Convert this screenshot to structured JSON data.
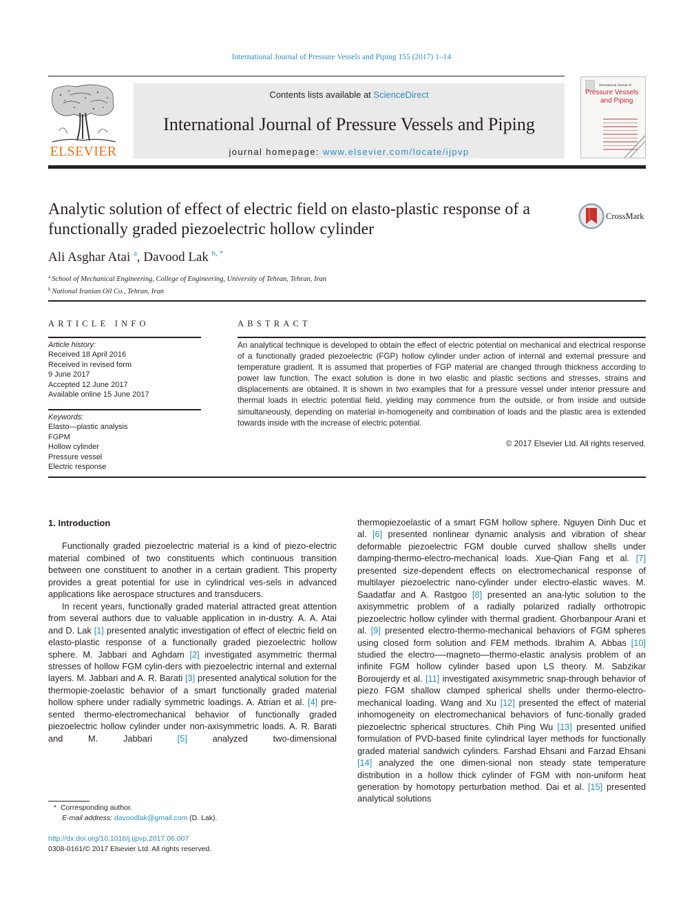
{
  "running_head": "International Journal of Pressure Vessels and Piping 155 (2017) 1–14",
  "masthead": {
    "publisher": "ELSEVIER",
    "contents_prefix": "Contents lists available at ",
    "contents_link": "ScienceDirect",
    "journal_title": "International Journal of Pressure Vessels and Piping",
    "homepage_prefix": "journal homepage: ",
    "homepage_link": "www.elsevier.com/locate/ijpvp",
    "cover": {
      "small_text": "International Journal of",
      "title_line1": "Pressure Vessels",
      "title_line2": "and Piping"
    },
    "brand_color": "#e9711c",
    "link_color": "#2a8cbf"
  },
  "article": {
    "title": "Analytic solution of effect of electric field on elasto-plastic response of a functionally graded piezoelectric hollow cylinder",
    "crossmark_label": "CrossMark",
    "authors": [
      {
        "name": "Ali Asghar Atai",
        "sup": "a"
      },
      {
        "name": "Davood Lak",
        "sup": "b, *"
      }
    ],
    "author_separator": ", ",
    "affiliations": [
      {
        "sup": "a",
        "text": "School of Mechanical Engineering, College of Engineering, University of Tehran, Tehran, Iran"
      },
      {
        "sup": "b",
        "text": "National Iranian Oil Co., Tehran, Iran"
      }
    ]
  },
  "article_info": {
    "heading": "ARTICLE INFO",
    "history_label": "Article history:",
    "history": [
      "Received 18 April 2016",
      "Received in revised form",
      "9 June 2017",
      "Accepted 12 June 2017",
      "Available online 15 June 2017"
    ],
    "keywords_label": "Keywords:",
    "keywords": [
      "Elasto—plastic analysis",
      "FGPM",
      "Hollow cylinder",
      "Pressure vessel",
      "Electric response"
    ]
  },
  "abstract": {
    "heading": "ABSTRACT",
    "text": "An analytical technique is developed to obtain the effect of electric potential on mechanical and electrical response of a functionally graded piezoelectric (FGP) hollow cylinder under action of internal and external pressure and temperature gradient. It is assumed that properties of FGP material are changed through thickness according to power law function. The exact solution is done in two elastic and plastic sections and stresses, strains and displacements are obtained. It is shown in two examples that for a pressure vessel under interior pressure and thermal loads in electric potential field, yielding may commence from the outside, or from inside and outside simultaneously, depending on material in-homogeneity and combination of loads and the plastic area is extended towards inside with the increase of electric potential.",
    "copyright": "© 2017 Elsevier Ltd. All rights reserved."
  },
  "body": {
    "section_title": "1.  Introduction",
    "left_paragraphs": [
      [
        {
          "t": "Functionally graded piezoelectric material is a kind of piezo-electric material combined of two constituents which continuous transition between one constituent to another in a certain gradient. This property provides a great potential for use in cylindrical ves-sels in advanced applications like aerospace structures and transducers."
        }
      ],
      [
        {
          "t": "In recent years, functionally graded material attracted great attention from several authors due to valuable application in in-dustry. A. A. Atai and D. Lak "
        },
        {
          "r": "[1]"
        },
        {
          "t": " presented analytic investigation of effect of electric field on elasto-plastic response of a functionally graded piezoelectric hollow sphere. M. Jabbari and Aghdam "
        },
        {
          "r": "[2]"
        },
        {
          "t": " investigated asymmetric thermal stresses of hollow FGM cylin-ders with piezoelectric internal and external layers. M. Jabbari and A. R. Barati "
        },
        {
          "r": "[3]"
        },
        {
          "t": " presented analytical solution for the thermopie-zoelastic behavior of a smart functionally graded material hollow sphere under radially symmetric loadings. A. Atrian et al. "
        },
        {
          "r": "[4]"
        },
        {
          "t": " pre-sented thermo-electromechanical behavior of functionally graded piezoelectric hollow cylinder under non-axisymmetric loads. A. R. Barati and M. Jabbari "
        },
        {
          "r": "[5]"
        },
        {
          "t": " analyzed two-dimensional"
        }
      ]
    ],
    "right_paragraph": [
      {
        "t": "thermopiezoelastic of a smart FGM hollow sphere. Nguyen Dinh Duc et al. "
      },
      {
        "r": "[6]"
      },
      {
        "t": " presented nonlinear dynamic analysis and vibration of shear deformable piezoelectric FGM double curved shallow shells under damping-thermo-electro-mechanical loads. Xue-Qian Fang et al. "
      },
      {
        "r": "[7]"
      },
      {
        "t": " presented size-dependent effects on electromechanical response of multilayer piezoelectric nano-cylinder under electro-elastic waves. M. Saadatfar and A. Rastgoo "
      },
      {
        "r": "[8]"
      },
      {
        "t": " presented an ana-lytic solution to the axisymmetric problem of a radially polarized radially orthotropic piezoelectric hollow cylinder with thermal gradient. Ghorbanpour Arani et al. "
      },
      {
        "r": "[9]"
      },
      {
        "t": " presented electro-thermo-mechanical behaviors of FGM spheres using closed form solution and FEM methods. Ibrahim A. Abbas "
      },
      {
        "r": "[10]"
      },
      {
        "t": " studied the electro-—magneto—thermo-elastic analysis problem of an infinite FGM hollow cylinder based upon LS theory. M. Sabzikar Boroujerdy et al. "
      },
      {
        "r": "[11]"
      },
      {
        "t": " investigated axisymmetric snap-through behavior of piezo FGM shallow clamped spherical shells under thermo-electro-mechanical loading. Wang and Xu "
      },
      {
        "r": "[12]"
      },
      {
        "t": " presented the effect of material inhomogeneity on electromechanical behaviors of func-tionally graded piezoelectric spherical structures. Chih Ping Wu "
      },
      {
        "r": "[13]"
      },
      {
        "t": " presented unified formulation of PVD-based finite cylindrical layer methods for functionally graded material sandwich cylinders. Farshad Ehsani and Farzad Ehsani "
      },
      {
        "r": "[14]"
      },
      {
        "t": " analyzed the one dimen-sional non steady state temperature distribution in a hollow thick cylinder of FGM with non-uniform heat generation by homotopy perturbation method. Dai et al. "
      },
      {
        "r": "[15]"
      },
      {
        "t": " presented analytical solutions"
      }
    ]
  },
  "footnote": {
    "marker": "*",
    "corresponding": "Corresponding author.",
    "email_label": "E-mail address:",
    "email": "davoodlak@gmail.com",
    "email_suffix": " (D. Lak)."
  },
  "doi": {
    "link": "http://dx.doi.org/10.1016/j.ijpvp.2017.06.007",
    "issn_line": "0308-0161/© 2017 Elsevier Ltd. All rights reserved."
  }
}
